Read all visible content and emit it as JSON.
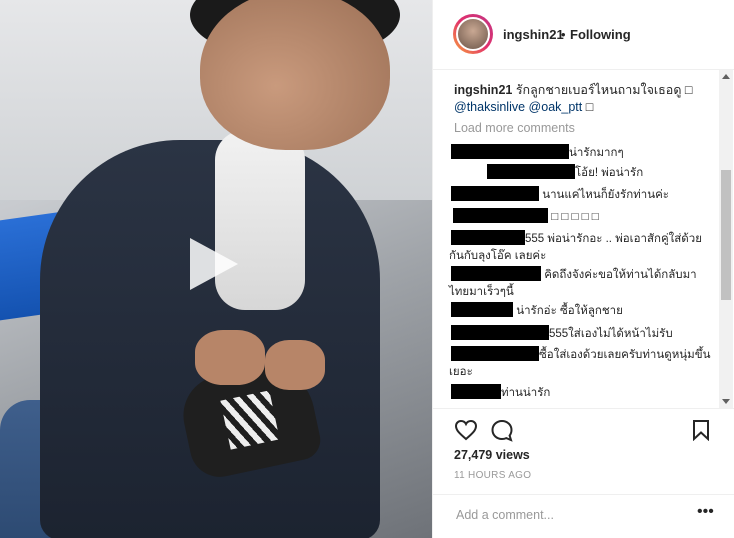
{
  "post": {
    "username": "ingshin21",
    "separator": "•",
    "follow_state": "Following",
    "caption_user": "ingshin21",
    "caption_text": " รักลูกชายเบอร์ไหนถามใจเธอดู ",
    "caption_emoji": "□",
    "mention_1": "@thaksinlive",
    "mention_2": "@oak_ptt",
    "mention_tail": " □",
    "load_more": "Load more comments",
    "views": "27,479 views",
    "time_ago": "11 HOURS AGO"
  },
  "comments": [
    {
      "text": "น่ารักมากๆ"
    },
    {
      "text": "โอ้ย! พ่อน่ารัก"
    },
    {
      "text": "นานแค่ไหนก็ยังรักท่านค่ะ"
    },
    {
      "text": "□ □ □ □ □"
    },
    {
      "text": "555 พ่อน่ารักอะ .. พ่อเอาสักคู่ใส่ด้วยกันกับลุงโอ๊ค เลยค่ะ"
    },
    {
      "text": "คิดถึงจังค่ะขอให้ท่านได้กลับมาไทยมาเร็วๆนี้"
    },
    {
      "text": "น่ารักอ่ะ ซื้อให้ลูกชาย"
    },
    {
      "text": "555ใส่เองไม่ได้หน้าไม่รับ"
    },
    {
      "text": "ซื้อใส่เองด้วยเลยครับท่านดูหนุ่มขึ้นเยอะ"
    },
    {
      "text": "ท่านน่ารัก"
    }
  ],
  "add_comment": {
    "placeholder": "Add a comment..."
  },
  "icons": {
    "like": "heart-icon",
    "comment": "comment-icon",
    "save": "bookmark-icon",
    "play": "play-icon",
    "more": "more-options-icon"
  },
  "colors": {
    "link": "#003569",
    "muted": "#999999",
    "text": "#262626"
  }
}
